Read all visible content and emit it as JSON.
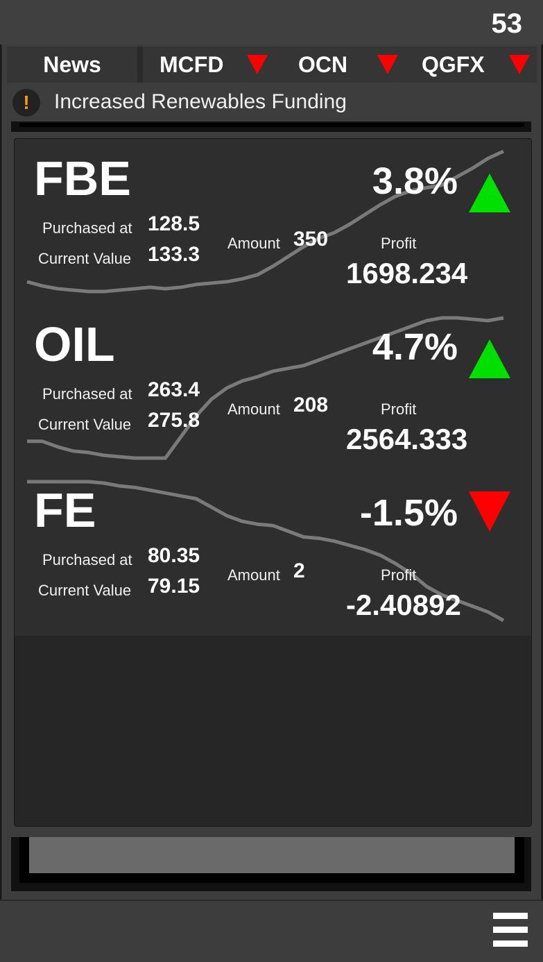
{
  "header": {
    "counter": "53"
  },
  "tabs": {
    "news_label": "News",
    "tickers": [
      {
        "symbol": "MCFD",
        "direction": "down"
      },
      {
        "symbol": "OCN",
        "direction": "down"
      },
      {
        "symbol": "QGFX",
        "direction": "down"
      }
    ]
  },
  "news": {
    "icon": "alert-icon",
    "text": "Increased Renewables Funding",
    "icon_glyph": "!"
  },
  "labels": {
    "purchased_at": "Purchased at",
    "current_value": "Current Value",
    "amount": "Amount",
    "profit": "Profit"
  },
  "stocks": [
    {
      "symbol": "FBE",
      "purchased_at": "128.5",
      "current_value": "133.3",
      "amount": "350",
      "change_pct": "3.8%",
      "profit": "1698.234",
      "trend": "up",
      "sparkline": [
        0.07,
        0.04,
        0.02,
        0.01,
        0.0,
        0.0,
        0.01,
        0.02,
        0.03,
        0.02,
        0.03,
        0.05,
        0.06,
        0.07,
        0.09,
        0.12,
        0.18,
        0.25,
        0.32,
        0.38,
        0.42,
        0.48,
        0.55,
        0.62,
        0.68,
        0.72,
        0.74,
        0.76,
        0.82,
        0.88,
        0.95,
        1.0
      ]
    },
    {
      "symbol": "OIL",
      "purchased_at": "263.4",
      "current_value": "275.8",
      "amount": "208",
      "change_pct": "4.7%",
      "profit": "2564.333",
      "trend": "up",
      "sparkline": [
        0.12,
        0.12,
        0.08,
        0.05,
        0.04,
        0.02,
        0.01,
        0.0,
        0.0,
        0.0,
        0.15,
        0.3,
        0.42,
        0.5,
        0.55,
        0.58,
        0.62,
        0.64,
        0.66,
        0.7,
        0.74,
        0.78,
        0.82,
        0.86,
        0.9,
        0.94,
        0.98,
        1.0,
        1.0,
        0.99,
        0.98,
        1.0
      ]
    },
    {
      "symbol": "FE",
      "purchased_at": "80.35",
      "current_value": "79.15",
      "amount": "2",
      "change_pct": "-1.5%",
      "profit": "-2.40892",
      "trend": "down",
      "sparkline": [
        1.0,
        1.0,
        1.0,
        1.0,
        1.0,
        0.99,
        0.97,
        0.96,
        0.94,
        0.92,
        0.9,
        0.88,
        0.82,
        0.76,
        0.72,
        0.7,
        0.69,
        0.65,
        0.61,
        0.6,
        0.58,
        0.55,
        0.52,
        0.48,
        0.42,
        0.35,
        0.26,
        0.2,
        0.16,
        0.12,
        0.08,
        0.02
      ]
    }
  ],
  "footer": {
    "menu_icon": "hamburger-menu-icon"
  },
  "colors": {
    "up": "#00e000",
    "down": "#ff0000",
    "sparkline": "#7a7a7a",
    "alert": "#ff9a1a"
  }
}
